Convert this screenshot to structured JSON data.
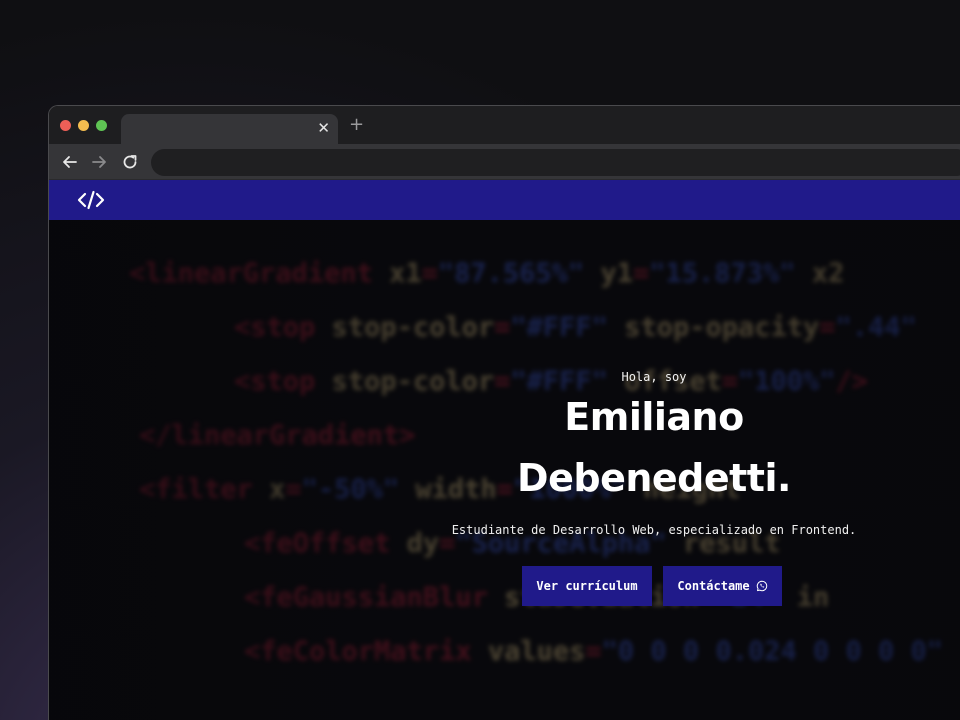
{
  "browser": {
    "tab": {
      "title": "",
      "close_glyph": "✕"
    },
    "new_tab_glyph": "+",
    "address": {
      "url": ""
    }
  },
  "site": {
    "nav": {
      "logo": "code-brackets-icon"
    },
    "hero": {
      "greeting": "Hola, soy",
      "name_line1": "Emiliano",
      "name_line2": "Debenedetti.",
      "subtitle": "Estudiante de Desarrollo Web, especializado en Frontend.",
      "buttons": {
        "cv_label": "Ver currículum",
        "contact_label": "Contáctame",
        "contact_icon": "whatsapp-icon"
      }
    }
  },
  "colors": {
    "accent": "#201a8a",
    "page_background": "#0b0b0d"
  }
}
